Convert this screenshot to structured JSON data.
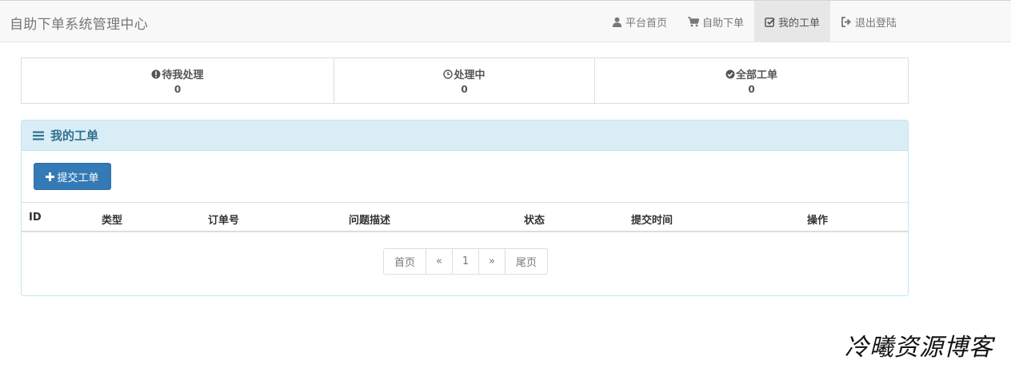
{
  "brand": "自助下单系统管理中心",
  "nav": {
    "home": "平台首页",
    "order": "自助下单",
    "my_tickets": "我的工单",
    "logout": "退出登陆"
  },
  "stats": {
    "pending_label": "待我处理",
    "pending_value": "0",
    "processing_label": "处理中",
    "processing_value": "0",
    "all_label": "全部工单",
    "all_value": "0"
  },
  "panel": {
    "title": "我的工单",
    "submit_label": "提交工单"
  },
  "table": {
    "columns": [
      "ID",
      "类型",
      "订单号",
      "问题描述",
      "状态",
      "提交时间",
      "操作"
    ]
  },
  "pagination": {
    "first": "首页",
    "prev": "«",
    "current": "1",
    "next": "»",
    "last": "尾页"
  },
  "watermark": "冷曦资源博客",
  "colors": {
    "primary": "#337ab7",
    "panel_heading_bg": "#d9edf7",
    "panel_heading_text": "#31708f",
    "navbar_bg": "#f8f8f8"
  }
}
